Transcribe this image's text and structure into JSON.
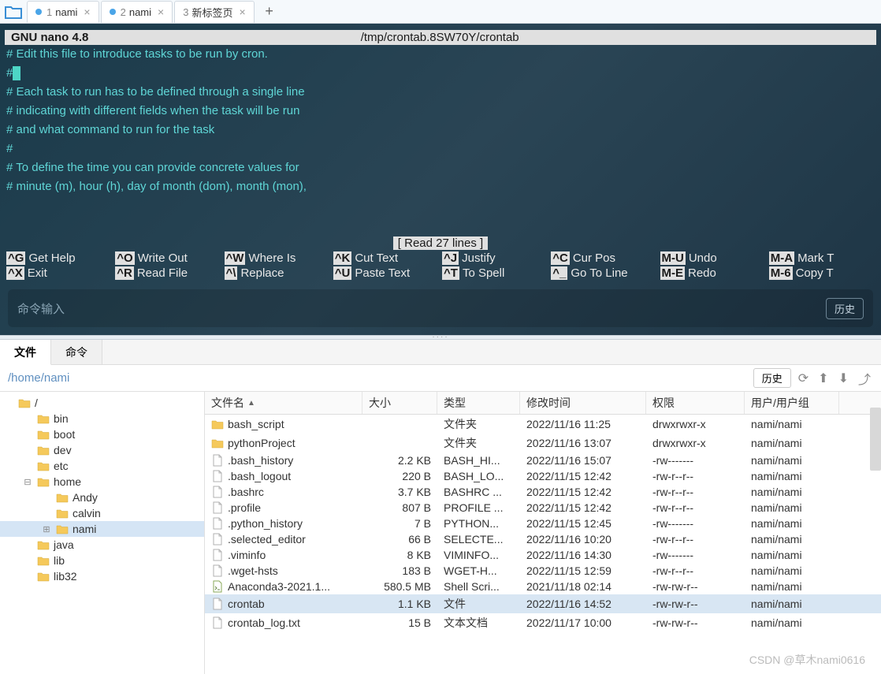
{
  "tabs": [
    {
      "num": "1",
      "label": "nami",
      "modified": true
    },
    {
      "num": "2",
      "label": "nami",
      "modified": true
    },
    {
      "num": "3",
      "label": "新标签页",
      "modified": false
    }
  ],
  "terminal": {
    "nano_title": "GNU nano 4.8",
    "nano_path": "/tmp/crontab.8SW70Y/crontab",
    "lines": [
      "# Edit this file to introduce tasks to be run by cron.",
      "#",
      "# Each task to run has to be defined through a single line",
      "# indicating with different fields when the task will be run",
      "# and what command to run for the task",
      "#",
      "# To define the time you can provide concrete values for",
      "# minute (m), hour (h), day of month (dom), month (mon),"
    ],
    "status": "[ Read 27 lines ]",
    "footer": [
      {
        "k": "^G",
        "a": "Get Help"
      },
      {
        "k": "^O",
        "a": "Write Out"
      },
      {
        "k": "^W",
        "a": "Where Is"
      },
      {
        "k": "^K",
        "a": "Cut Text"
      },
      {
        "k": "^J",
        "a": "Justify"
      },
      {
        "k": "^C",
        "a": "Cur Pos"
      },
      {
        "k": "M-U",
        "a": "Undo"
      },
      {
        "k": "M-A",
        "a": "Mark T"
      },
      {
        "k": "^X",
        "a": "Exit"
      },
      {
        "k": "^R",
        "a": "Read File"
      },
      {
        "k": "^\\",
        "a": "Replace"
      },
      {
        "k": "^U",
        "a": "Paste Text"
      },
      {
        "k": "^T",
        "a": "To Spell"
      },
      {
        "k": "^_",
        "a": "Go To Line"
      },
      {
        "k": "M-E",
        "a": "Redo"
      },
      {
        "k": "M-6",
        "a": "Copy T"
      }
    ],
    "cmd_placeholder": "命令输入",
    "history_btn": "历史"
  },
  "bottom": {
    "tabs": {
      "files": "文件",
      "commands": "命令"
    },
    "path": "/home/nami",
    "history_btn": "历史",
    "tree": [
      {
        "label": "/",
        "depth": 0,
        "expanded": true
      },
      {
        "label": "bin",
        "depth": 1
      },
      {
        "label": "boot",
        "depth": 1
      },
      {
        "label": "dev",
        "depth": 1
      },
      {
        "label": "etc",
        "depth": 1
      },
      {
        "label": "home",
        "depth": 1,
        "expanded": true,
        "expander": "⊟"
      },
      {
        "label": "Andy",
        "depth": 2
      },
      {
        "label": "calvin",
        "depth": 2
      },
      {
        "label": "nami",
        "depth": 2,
        "selected": true,
        "expander": "⊞"
      },
      {
        "label": "java",
        "depth": 1
      },
      {
        "label": "lib",
        "depth": 1
      },
      {
        "label": "lib32",
        "depth": 1
      }
    ],
    "headers": {
      "name": "文件名",
      "size": "大小",
      "type": "类型",
      "mtime": "修改时间",
      "perm": "权限",
      "owner": "用户/用户组"
    },
    "rows": [
      {
        "name": "bash_script",
        "size": "",
        "type": "文件夹",
        "mtime": "2022/11/16 11:25",
        "perm": "drwxrwxr-x",
        "owner": "nami/nami",
        "icon": "folder"
      },
      {
        "name": "pythonProject",
        "size": "",
        "type": "文件夹",
        "mtime": "2022/11/16 13:07",
        "perm": "drwxrwxr-x",
        "owner": "nami/nami",
        "icon": "folder"
      },
      {
        "name": ".bash_history",
        "size": "2.2 KB",
        "type": "BASH_HI...",
        "mtime": "2022/11/16 15:07",
        "perm": "-rw-------",
        "owner": "nami/nami",
        "icon": "file"
      },
      {
        "name": ".bash_logout",
        "size": "220 B",
        "type": "BASH_LO...",
        "mtime": "2022/11/15 12:42",
        "perm": "-rw-r--r--",
        "owner": "nami/nami",
        "icon": "file"
      },
      {
        "name": ".bashrc",
        "size": "3.7 KB",
        "type": "BASHRC ...",
        "mtime": "2022/11/15 12:42",
        "perm": "-rw-r--r--",
        "owner": "nami/nami",
        "icon": "file"
      },
      {
        "name": ".profile",
        "size": "807 B",
        "type": "PROFILE ...",
        "mtime": "2022/11/15 12:42",
        "perm": "-rw-r--r--",
        "owner": "nami/nami",
        "icon": "file"
      },
      {
        "name": ".python_history",
        "size": "7 B",
        "type": "PYTHON...",
        "mtime": "2022/11/15 12:45",
        "perm": "-rw-------",
        "owner": "nami/nami",
        "icon": "file"
      },
      {
        "name": ".selected_editor",
        "size": "66 B",
        "type": "SELECTE...",
        "mtime": "2022/11/16 10:20",
        "perm": "-rw-r--r--",
        "owner": "nami/nami",
        "icon": "file"
      },
      {
        "name": ".viminfo",
        "size": "8 KB",
        "type": "VIMINFO...",
        "mtime": "2022/11/16 14:30",
        "perm": "-rw-------",
        "owner": "nami/nami",
        "icon": "file"
      },
      {
        "name": ".wget-hsts",
        "size": "183 B",
        "type": "WGET-H...",
        "mtime": "2022/11/15 12:59",
        "perm": "-rw-r--r--",
        "owner": "nami/nami",
        "icon": "file"
      },
      {
        "name": "Anaconda3-2021.1...",
        "size": "580.5 MB",
        "type": "Shell Scri...",
        "mtime": "2021/11/18 02:14",
        "perm": "-rw-rw-r--",
        "owner": "nami/nami",
        "icon": "script"
      },
      {
        "name": "crontab",
        "size": "1.1 KB",
        "type": "文件",
        "mtime": "2022/11/16 14:52",
        "perm": "-rw-rw-r--",
        "owner": "nami/nami",
        "icon": "file",
        "selected": true
      },
      {
        "name": "crontab_log.txt",
        "size": "15 B",
        "type": "文本文档",
        "mtime": "2022/11/17 10:00",
        "perm": "-rw-rw-r--",
        "owner": "nami/nami",
        "icon": "file"
      }
    ]
  },
  "watermark": "CSDN @草木nami0616"
}
